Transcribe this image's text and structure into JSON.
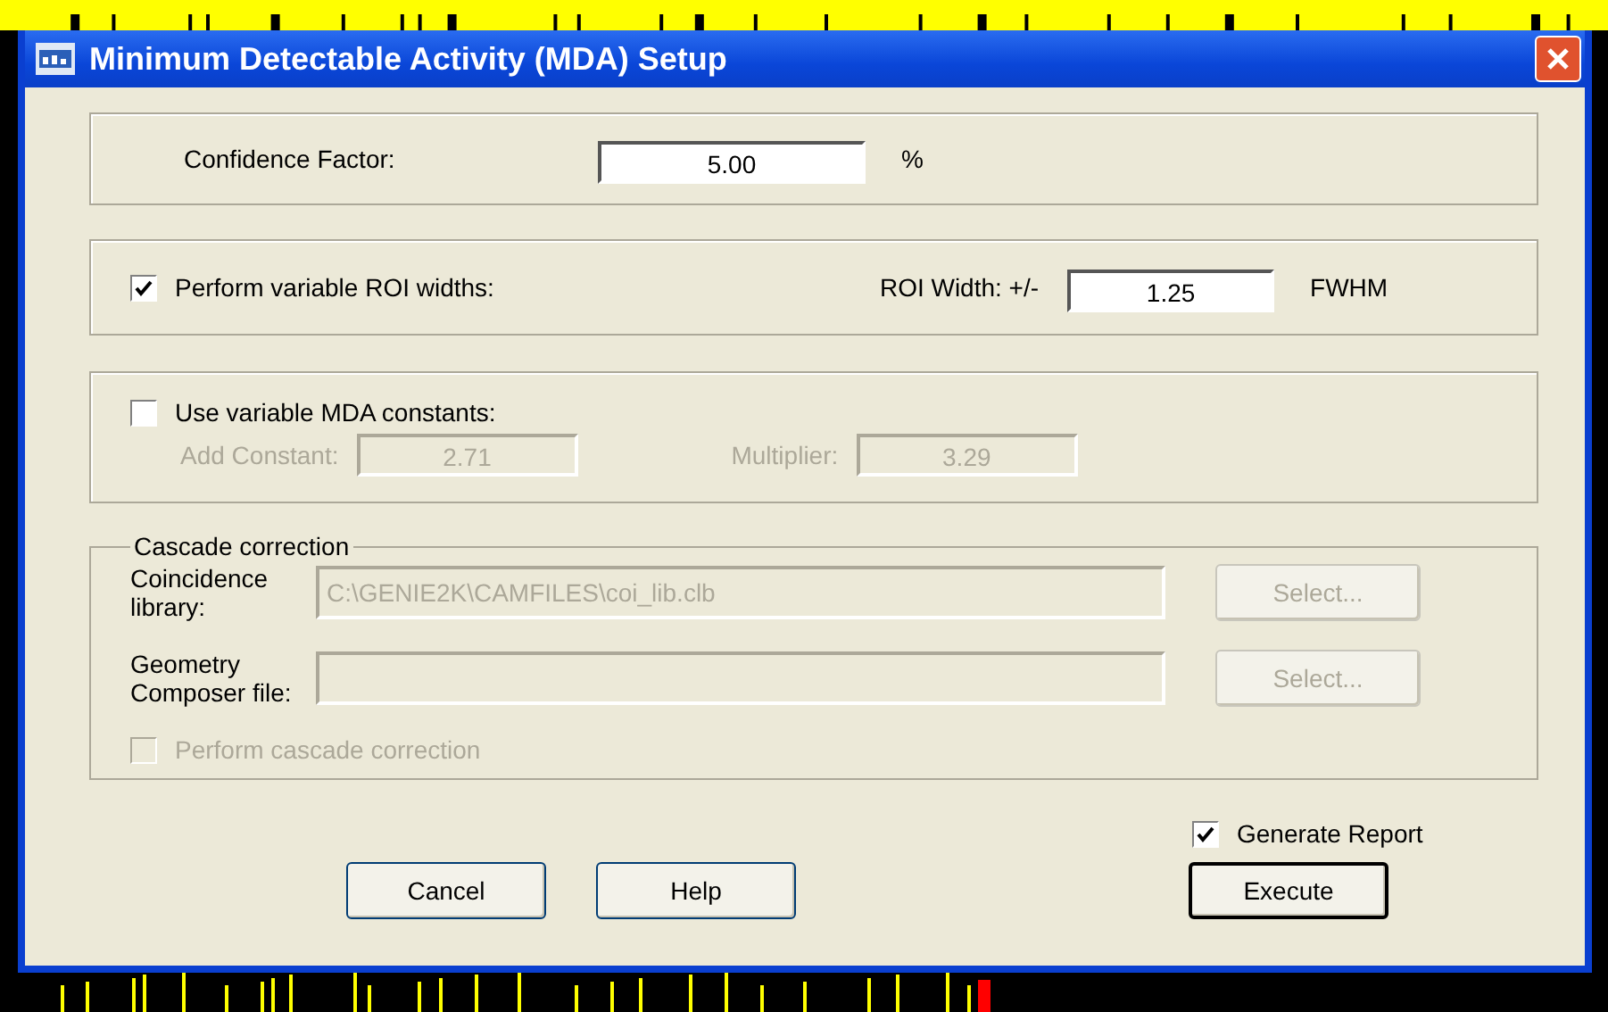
{
  "window": {
    "title": "Minimum Detectable Activity (MDA) Setup"
  },
  "confidence": {
    "label": "Confidence Factor:",
    "value": "5.00",
    "unit": "%"
  },
  "roi": {
    "checkbox": {
      "label": "Perform variable ROI widths:",
      "checked": true
    },
    "width_label": "ROI Width: +/-",
    "value": "1.25",
    "unit": "FWHM"
  },
  "mda": {
    "checkbox": {
      "label": "Use variable MDA constants:",
      "checked": false
    },
    "fields": [
      {
        "label": "Add Constant:",
        "value": "2.71",
        "disabled": true
      },
      {
        "label": "Multiplier:",
        "value": "3.29",
        "disabled": true
      }
    ]
  },
  "cascade": {
    "title": "Cascade correction",
    "rows": [
      {
        "label": "Coincidence library:",
        "value": "C:\\GENIE2K\\CAMFILES\\coi_lib.clb",
        "button": "Select...",
        "disabled": true
      },
      {
        "label": "Geometry Composer file:",
        "button": "Select...",
        "disabled": true
      }
    ],
    "checkbox": {
      "label": "Perform cascade correction",
      "checked": false,
      "disabled": true
    }
  },
  "generate_report": {
    "label": "Generate Report",
    "checked": true
  },
  "buttons": [
    {
      "label": "Cancel",
      "default": false
    },
    {
      "label": "Help",
      "default": false
    },
    {
      "label": "Execute",
      "default": true
    }
  ]
}
